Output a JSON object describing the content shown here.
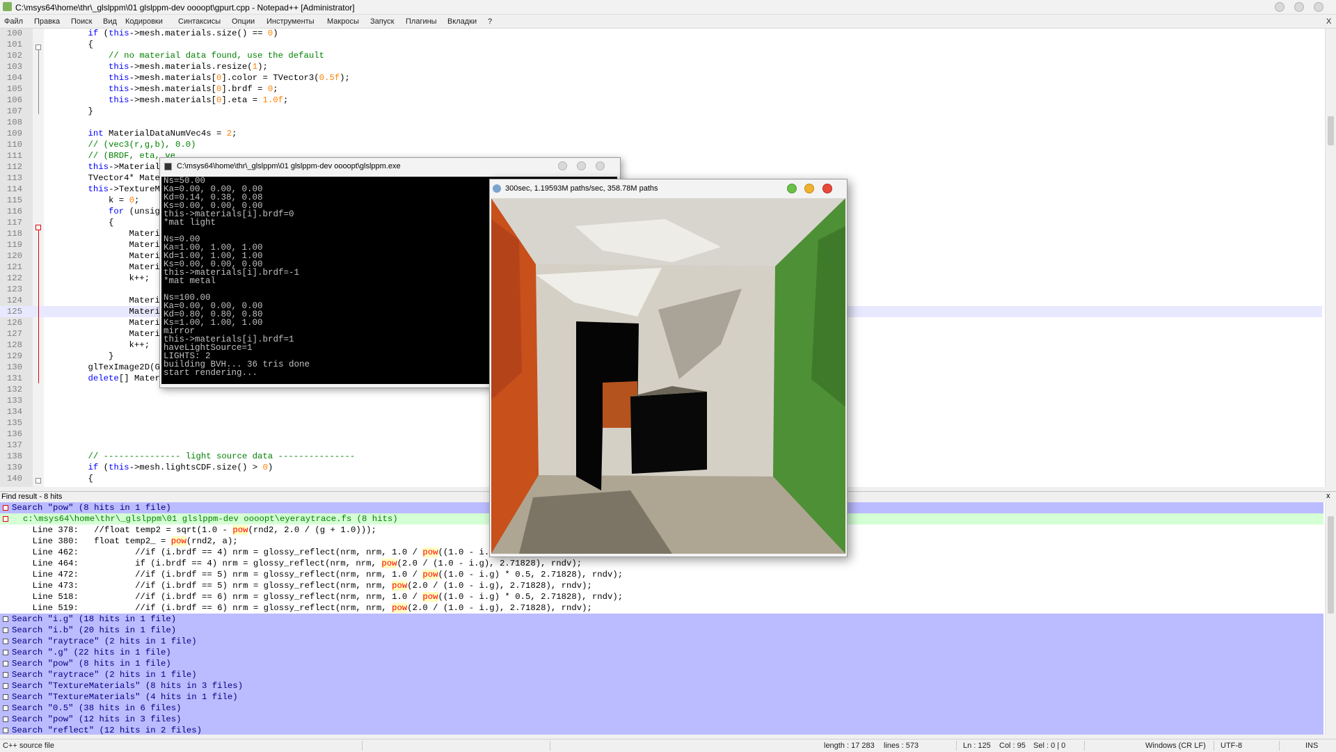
{
  "window": {
    "title": "C:\\msys64\\home\\thr\\_glslppm\\01 glslppm-dev oooopt\\gpurt.cpp - Notepad++ [Administrator]"
  },
  "menu": [
    "Файл",
    "Правка",
    "Поиск",
    "Вид",
    "Кодировки",
    "Синтаксисы",
    "Опции",
    "Инструменты",
    "Макросы",
    "Запуск",
    "Плагины",
    "Вкладки",
    "?"
  ],
  "menu_close": "X",
  "editor": {
    "current_line": "125",
    "lines": [
      {
        "n": "100",
        "code": "    if (this->mesh.materials.size() == 0)"
      },
      {
        "n": "101",
        "code": "    {"
      },
      {
        "n": "102",
        "code": "        // no material data found, use the default"
      },
      {
        "n": "103",
        "code": "        this->mesh.materials.resize(1);"
      },
      {
        "n": "104",
        "code": "        this->mesh.materials[0].color = TVector3(0.5f);"
      },
      {
        "n": "105",
        "code": "        this->mesh.materials[0].brdf = 0;"
      },
      {
        "n": "106",
        "code": "        this->mesh.materials[0].eta = 1.0f;"
      },
      {
        "n": "107",
        "code": "    }"
      },
      {
        "n": "108",
        "code": ""
      },
      {
        "n": "109",
        "code": "    int MaterialDataNumVec4s = 2;"
      },
      {
        "n": "110",
        "code": "    // (vec3(r,g,b), 0.0)"
      },
      {
        "n": "111",
        "code": "    // (BRDF, eta, ve"
      },
      {
        "n": "112",
        "code": "    this->MaterialDat"
      },
      {
        "n": "113",
        "code": "    TVector4* Materia"
      },
      {
        "n": "114",
        "code": "    this->TextureMat"
      },
      {
        "n": "115",
        "code": "        k = 0;"
      },
      {
        "n": "116",
        "code": "        for (unsigne"
      },
      {
        "n": "117",
        "code": "        {"
      },
      {
        "n": "118",
        "code": "            Material"
      },
      {
        "n": "119",
        "code": "            Material"
      },
      {
        "n": "120",
        "code": "            Material"
      },
      {
        "n": "121",
        "code": "            Material"
      },
      {
        "n": "122",
        "code": "            k++;"
      },
      {
        "n": "123",
        "code": ""
      },
      {
        "n": "124",
        "code": "            Material"
      },
      {
        "n": "125",
        "code": "            Material"
      },
      {
        "n": "126",
        "code": "            Material"
      },
      {
        "n": "127",
        "code": "            Material"
      },
      {
        "n": "128",
        "code": "            k++;"
      },
      {
        "n": "129",
        "code": "        }"
      },
      {
        "n": "130",
        "code": "    glTexImage2D(GL_"
      },
      {
        "n": "131",
        "code": "    delete[] Material"
      },
      {
        "n": "132",
        "code": ""
      },
      {
        "n": "133",
        "code": ""
      },
      {
        "n": "134",
        "code": ""
      },
      {
        "n": "135",
        "code": ""
      },
      {
        "n": "136",
        "code": ""
      },
      {
        "n": "137",
        "code": ""
      },
      {
        "n": "138",
        "code": "    // --------------- light source data ---------------"
      },
      {
        "n": "139",
        "code": "    if (this->mesh.lightsCDF.size() > 0)"
      },
      {
        "n": "140",
        "code": "    {"
      }
    ]
  },
  "console": {
    "title": "C:\\msys64\\home\\thr\\_glslppm\\01 glslppm-dev oooopt\\glslppm.exe",
    "lines": [
      "Ns=50.00",
      "Ka=0.00, 0.00, 0.00",
      "Kd=0.14, 0.38, 0.08",
      "Ks=0.00, 0.00, 0.00",
      "this->materials[i].brdf=0",
      "*mat light",
      "",
      "Ns=0.00",
      "Ka=1.00, 1.00, 1.00",
      "Kd=1.00, 1.00, 1.00",
      "Ks=0.00, 0.00, 0.00",
      "this->materials[i].brdf=-1",
      "*mat metal",
      "",
      "Ns=100.00",
      "Ka=0.00, 0.00, 0.00",
      "Kd=0.80, 0.80, 0.80",
      "Ks=1.00, 1.00, 1.00",
      "mirror",
      "this->materials[i].brdf=1",
      "haveLightSource=1",
      "LIGHTS: 2",
      "building BVH... 36 tris done",
      "start rendering..."
    ]
  },
  "render_window": {
    "title": "300sec, 1.19593M paths/sec, 358.78M paths"
  },
  "find": {
    "header": "Find result - 8 hits",
    "close": "x",
    "lines": [
      {
        "type": "search",
        "text": "Search \"pow\" (8 hits in 1 file)"
      },
      {
        "type": "file",
        "text": "c:\\msys64\\home\\thr\\_glslppm\\01 glslppm-dev oooopt\\eyeraytrace.fs (8 hits)"
      },
      {
        "type": "hit",
        "pre": "    Line 378:   //float temp2 = sqrt(1.0 - ",
        "hl": "pow",
        "post": "(rnd2, 2.0 / (g + 1.0)));"
      },
      {
        "type": "hit",
        "pre": "    Line 380:   float temp2_ = ",
        "hl": "pow",
        "post": "(rnd2, a);"
      },
      {
        "type": "hit",
        "pre": "    Line 462:           //if (i.brdf == 4) nrm = glossy_reflect(nrm, nrm, 1.0 / ",
        "hl": "pow",
        "post": "((1.0 - i.g) * 0.5, 2.71828), rndv);"
      },
      {
        "type": "hit",
        "pre": "    Line 464:           if (i.brdf == 4) nrm = glossy_reflect(nrm, nrm, ",
        "hl": "pow",
        "post": "(2.0 / (1.0 - i.g), 2.71828), rndv);"
      },
      {
        "type": "hit",
        "pre": "    Line 472:           //if (i.brdf == 5) nrm = glossy_reflect(nrm, nrm, 1.0 / ",
        "hl": "pow",
        "post": "((1.0 - i.g) * 0.5, 2.71828), rndv);"
      },
      {
        "type": "hit",
        "pre": "    Line 473:           //if (i.brdf == 5) nrm = glossy_reflect(nrm, nrm, ",
        "hl": "pow",
        "post": "(2.0 / (1.0 - i.g), 2.71828), rndv);"
      },
      {
        "type": "hit",
        "pre": "    Line 518:           //if (i.brdf == 6) nrm = glossy_reflect(nrm, nrm, 1.0 / ",
        "hl": "pow",
        "post": "((1.0 - i.g) * 0.5, 2.71828), rndv);"
      },
      {
        "type": "hit",
        "pre": "    Line 519:           //if (i.brdf == 6) nrm = glossy_reflect(nrm, nrm, ",
        "hl": "pow",
        "post": "(2.0 / (1.0 - i.g), 2.71828), rndv);"
      },
      {
        "type": "search",
        "text": "Search \"i.g\" (18 hits in 1 file)"
      },
      {
        "type": "search",
        "text": "Search \"i.b\" (20 hits in 1 file)"
      },
      {
        "type": "search",
        "text": "Search \"raytrace\" (2 hits in 1 file)"
      },
      {
        "type": "search",
        "text": "Search \".g\" (22 hits in 1 file)"
      },
      {
        "type": "search",
        "text": "Search \"pow\" (8 hits in 1 file)"
      },
      {
        "type": "search",
        "text": "Search \"raytrace\" (2 hits in 1 file)"
      },
      {
        "type": "search",
        "text": "Search \"TextureMaterials\" (8 hits in 3 files)"
      },
      {
        "type": "search",
        "text": "Search \"TextureMaterials\" (4 hits in 1 file)"
      },
      {
        "type": "search",
        "text": "Search \"0.5\" (38 hits in 6 files)"
      },
      {
        "type": "search",
        "text": "Search \"pow\" (12 hits in 3 files)"
      },
      {
        "type": "search",
        "text": "Search \"reflect\" (12 hits in 2 files)"
      }
    ]
  },
  "status": {
    "filetype": "C++ source file",
    "length": "length : 17 283",
    "lines": "lines : 573",
    "ln": "Ln : 125",
    "col": "Col : 95",
    "sel": "Sel : 0 | 0",
    "eol": "Windows (CR LF)",
    "encoding": "UTF-8",
    "mode": "INS"
  },
  "colors": {
    "keyword": "#0000ff",
    "number": "#ff8000",
    "comment": "#008000",
    "search_row": "#bbbbff",
    "file_row": "#d5ffd5",
    "highlight": "#ff0000"
  }
}
